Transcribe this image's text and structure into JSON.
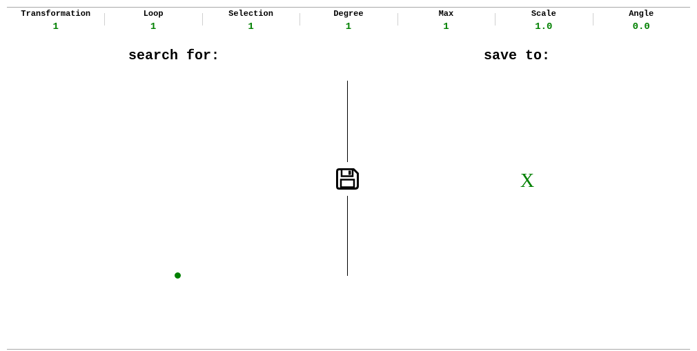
{
  "stats": [
    {
      "label": "Transformation",
      "value": "1"
    },
    {
      "label": "Loop",
      "value": "1"
    },
    {
      "label": "Selection",
      "value": "1"
    },
    {
      "label": "Degree",
      "value": "1"
    },
    {
      "label": "Max",
      "value": "1"
    },
    {
      "label": "Scale",
      "value": "1.0"
    },
    {
      "label": "Angle",
      "value": "0.0"
    }
  ],
  "search_panel": {
    "heading": "search for:"
  },
  "save_panel": {
    "heading": "save to:",
    "marker": "X"
  },
  "icons": {
    "save": "floppy-disk-icon",
    "search_marker": "dot-icon"
  },
  "colors": {
    "accent": "#008000",
    "text": "#000000",
    "rule": "#a8a8a8"
  }
}
